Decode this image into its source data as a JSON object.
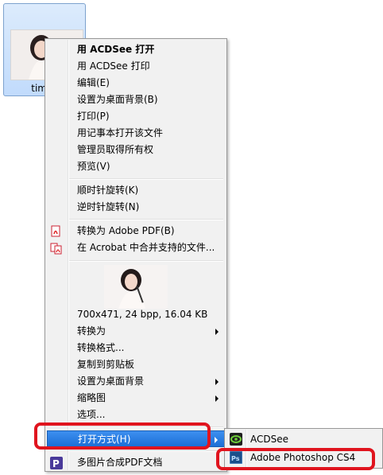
{
  "desktop": {
    "file_name": "tim"
  },
  "context_menu": {
    "items": [
      {
        "label": "用 ACDSee 打开"
      },
      {
        "label": "用 ACDSee 打印"
      },
      {
        "label": "编辑(E)"
      },
      {
        "label": "设置为桌面背景(B)"
      },
      {
        "label": "打印(P)"
      },
      {
        "label": "用记事本打开该文件"
      },
      {
        "label": "管理员取得所有权"
      },
      {
        "label": "预览(V)"
      },
      {
        "label": "顺时针旋转(K)"
      },
      {
        "label": "逆时针旋转(N)"
      },
      {
        "label": "转换为 Adobe PDF(B)"
      },
      {
        "label": "在 Acrobat 中合并支持的文件..."
      },
      {
        "label": "700x471, 24 bpp, 16.04 KB"
      },
      {
        "label": "转换为"
      },
      {
        "label": "转换格式..."
      },
      {
        "label": "复制到剪贴板"
      },
      {
        "label": "设置为桌面背景"
      },
      {
        "label": "缩略图"
      },
      {
        "label": "选项..."
      },
      {
        "label": "打开方式(H)"
      },
      {
        "label": "多图片合成PDF文档"
      }
    ]
  },
  "submenu": {
    "items": [
      {
        "label": "ACDSee"
      },
      {
        "label": "Adobe Photoshop CS4"
      }
    ]
  },
  "colors": {
    "highlight": "#1c6fd6",
    "annotation": "#e0141e"
  }
}
